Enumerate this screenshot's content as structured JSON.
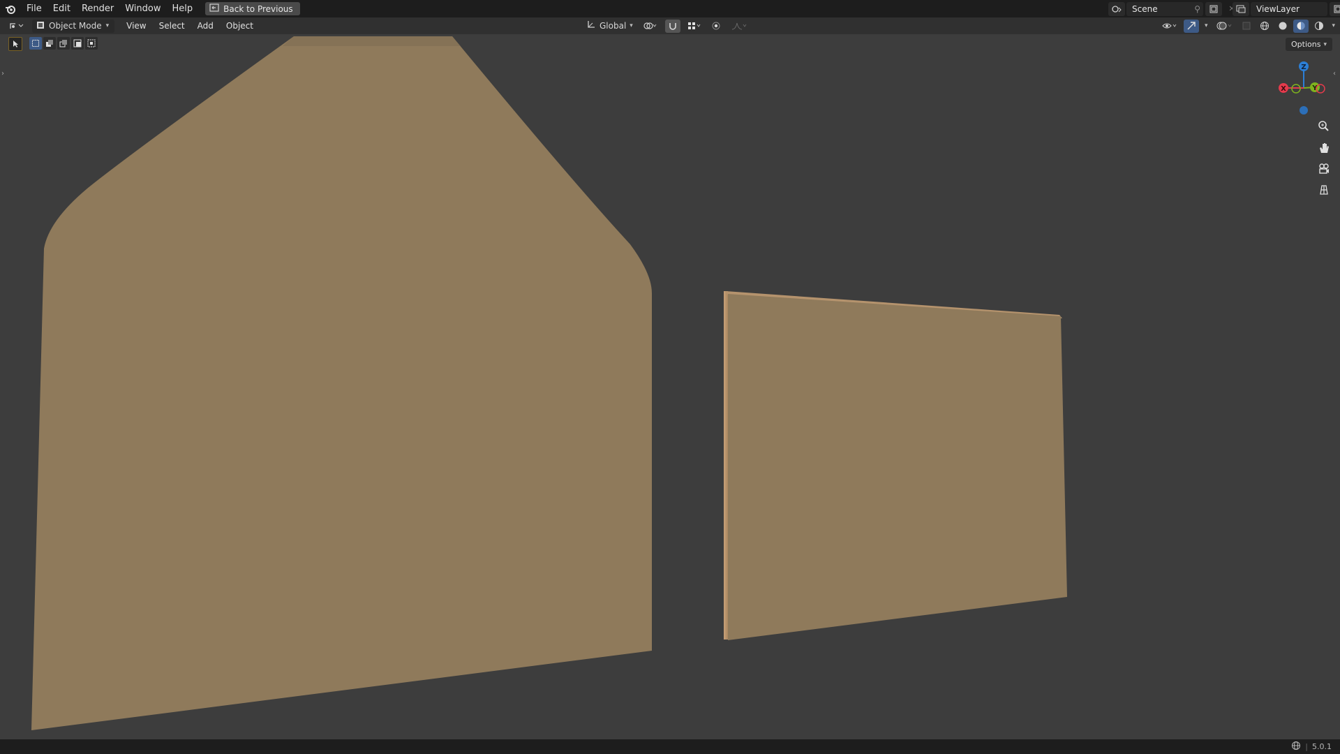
{
  "topbar": {
    "menu": [
      "File",
      "Edit",
      "Render",
      "Window",
      "Help"
    ],
    "back_label": "Back to Previous",
    "scene": "Scene",
    "view_layer": "ViewLayer"
  },
  "viewport_header": {
    "mode": "Object Mode",
    "menus": [
      "View",
      "Select",
      "Add",
      "Object"
    ],
    "orientation": "Global"
  },
  "options_label": "Options",
  "gizmo": {
    "x_label": "X",
    "y_label": "Y",
    "z_label": "Z"
  },
  "status": {
    "version": "5.0.1"
  },
  "colors": {
    "object_fill": "#8f7a5b",
    "object_edge": "#c29a72",
    "viewport_bg": "#3d3d3d",
    "axis_x": "#e53a4c",
    "axis_y": "#7fb31e",
    "axis_z": "#2c7fd6"
  }
}
